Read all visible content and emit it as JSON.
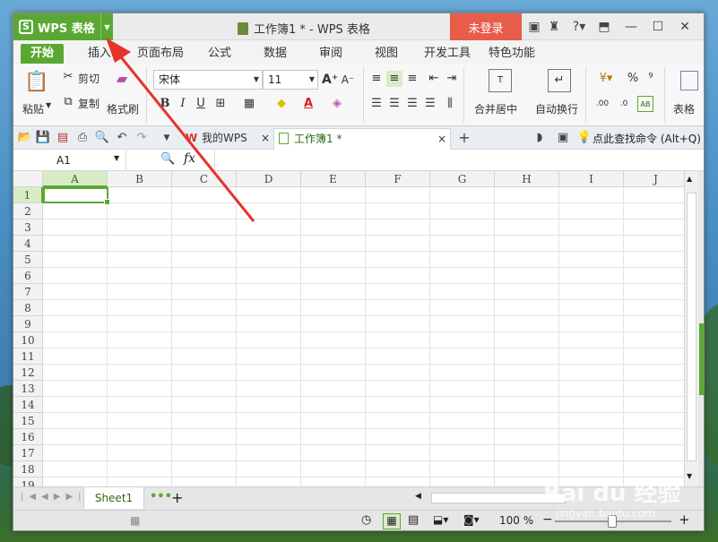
{
  "window": {
    "app_button": "WPS 表格",
    "title": "工作簿1 * - WPS 表格",
    "login_button": "未登录"
  },
  "tabs": [
    {
      "label": "开始"
    },
    {
      "label": "插入"
    },
    {
      "label": "页面布局"
    },
    {
      "label": "公式"
    },
    {
      "label": "数据"
    },
    {
      "label": "审阅"
    },
    {
      "label": "视图"
    },
    {
      "label": "开发工具"
    },
    {
      "label": "特色功能"
    }
  ],
  "ribbon": {
    "paste": "粘贴",
    "cut": "剪切",
    "copy": "复制",
    "format_painter": "格式刷",
    "font_name": "宋体",
    "font_size": "11",
    "bold": "B",
    "italic": "I",
    "underline": "U",
    "merge_center": "合并居中",
    "wrap_text": "自动换行",
    "percent": "%",
    "comma": "⁹",
    "table_style": "表格"
  },
  "quickbar": {
    "doc_tabs": [
      {
        "label": "我的WPS"
      },
      {
        "label": "工作簿1 *"
      }
    ],
    "search_command": "点此查找命令 (Alt+Q)"
  },
  "formula_bar": {
    "name_box": "A1",
    "fx": "fx"
  },
  "grid": {
    "columns": [
      "A",
      "B",
      "C",
      "D",
      "E",
      "F",
      "G",
      "H",
      "I",
      "J"
    ],
    "rows": [
      "1",
      "2",
      "3",
      "4",
      "5",
      "6",
      "7",
      "8",
      "9",
      "10",
      "11",
      "12",
      "13",
      "14",
      "15",
      "16",
      "17",
      "18",
      "19"
    ]
  },
  "sheets": [
    {
      "label": "Sheet1"
    }
  ],
  "status": {
    "zoom": "100 %"
  },
  "watermark": {
    "brand": "Bai du 经验",
    "url": "jingyan.baidu.com"
  },
  "colors": {
    "accent": "#5aa832",
    "login": "#e85c4a",
    "annotation": "#e8322a"
  }
}
